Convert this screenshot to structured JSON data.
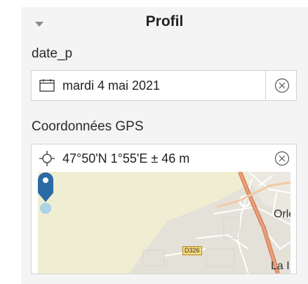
{
  "section": {
    "title": "Profil"
  },
  "date_field": {
    "label": "date_p",
    "value": "mardi 4 mai 2021",
    "icon": "calendar-icon",
    "clear_icon": "circle-x-icon"
  },
  "gps_field": {
    "label": "Coordonnées GPS",
    "value": "47°50'N 1°55'E ± 46 m",
    "icon": "crosshair-icon",
    "clear_icon": "circle-x-icon",
    "map": {
      "labels": [
        "Orlé",
        "La I"
      ],
      "road_number": "D326"
    }
  },
  "colors": {
    "panel_bg": "#f4f4f4",
    "pin": "#2c6aa6",
    "pin_halo": "#a9d3e6",
    "main_road": "#e0916a",
    "map_base": "#f0eed2",
    "urban": "#e4e1d8"
  }
}
